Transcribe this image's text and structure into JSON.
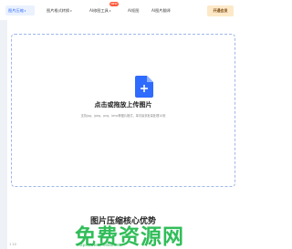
{
  "nav": {
    "items": [
      {
        "label": "图片压缩",
        "chevron": true,
        "active": true
      },
      {
        "label": "图片格式转换",
        "chevron": true,
        "active": false
      },
      {
        "label": "AI修图工具",
        "chevron": true,
        "active": false,
        "badge": "NEW"
      },
      {
        "label": "AI抠图",
        "chevron": false,
        "active": false
      },
      {
        "label": "AI图片翻译",
        "chevron": false,
        "active": false
      }
    ],
    "vip_button": "开通会员"
  },
  "upload": {
    "title": "点击或拖放上传图片",
    "hint": "支持jpg、jpeg、png、bmp等图片格式，单次最多批量处理10张",
    "icon": "file-plus-icon"
  },
  "section": {
    "title": "图片压缩核心优势"
  },
  "watermark": {
    "text": "免费资源网",
    "url": "https://www.freebuf.net"
  },
  "footer": {
    "left_text": "1 10"
  },
  "colors": {
    "accent": "#2f6bff",
    "vip_bg": "#fde9c8",
    "watermark": "#20b84b"
  }
}
